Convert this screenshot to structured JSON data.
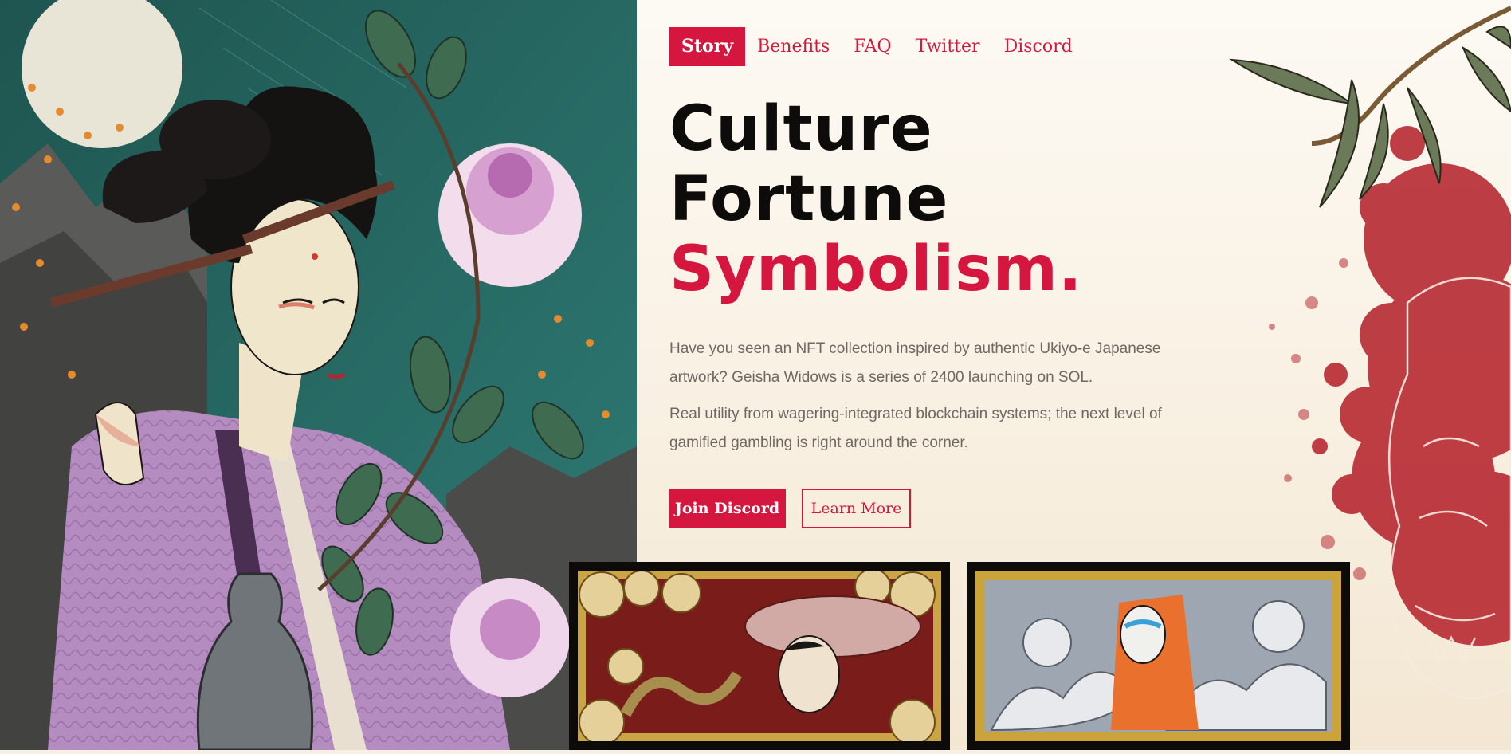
{
  "nav": {
    "items": [
      {
        "label": "Story",
        "active": true
      },
      {
        "label": "Benefits",
        "active": false
      },
      {
        "label": "FAQ",
        "active": false
      },
      {
        "label": "Twitter",
        "active": false
      },
      {
        "label": "Discord",
        "active": false
      }
    ]
  },
  "hero": {
    "headline": [
      "Culture",
      "Fortune",
      "Symbolism."
    ],
    "paragraph_1": "Have you seen an NFT collection inspired by authentic Ukiyo-e Japanese artwork? Geisha Widows is a series of 2400 launching on SOL.",
    "paragraph_2": "Real utility from wagering-integrated blockchain systems; the next level of gamified gambling is right around the corner.",
    "primary_button": "Join Discord",
    "secondary_button": "Learn More"
  },
  "colors": {
    "accent": "#d5163f",
    "heading": "#0d0c0b",
    "body_text": "#6f6862",
    "background": "#fbf6ec"
  },
  "icons": [
    "geisha-illustration",
    "bamboo-branch-decoration",
    "blood-splatter-decoration",
    "oni-mask-decoration",
    "nft-card-snake",
    "nft-card-waves"
  ]
}
